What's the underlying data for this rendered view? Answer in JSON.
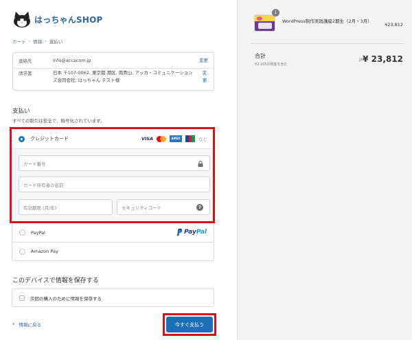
{
  "logo": {
    "text": "はっちゃんSHOP"
  },
  "breadcrumb": {
    "items": [
      "カート",
      "情報",
      "支払い"
    ],
    "separator": "›"
  },
  "contact": {
    "label": "連絡先",
    "value": "info@accacom.jp",
    "change": "変更"
  },
  "billing": {
    "label": "請求書",
    "value": "日本 〒107-0062, 東京都 港区, 南青山, アッカ・コミュニケーションズ合同会社, はっちゃん テスト様",
    "change": "変更"
  },
  "payment": {
    "title": "支払い",
    "subtitle": "すべての取引は安全で、暗号化されています。",
    "credit_card_label": "クレジットカード",
    "brands": {
      "visa": "VISA",
      "amex": "AMEX",
      "more": "など"
    },
    "card_number_placeholder": "カード番号",
    "card_name_placeholder": "カード所有者の名前",
    "expiry_placeholder": "有効期限 (月/年)",
    "security_placeholder": "セキュリティコード",
    "help_icon_text": "?",
    "paypal_label": "PayPal",
    "paypal_logo_a": "Pay",
    "paypal_logo_b": "Pal",
    "amazon_label": "Amazon Pay"
  },
  "save": {
    "title": "このデバイスで情報を保存する",
    "checkbox_label": "次回の購入のために情報を保存する"
  },
  "nav": {
    "back_label": "情報に戻る",
    "back_chevron": "‹",
    "pay_label": "今すぐ支払う"
  },
  "summary": {
    "product_name": "WordPress制作実践講座2期生（2月・3月）",
    "product_price": "¥23,812",
    "quantity": "1",
    "total_label": "合計",
    "tax_note": "¥2,165の税金を含む",
    "currency": "JPY",
    "total_value": "¥ 23,812"
  },
  "colors": {
    "accent": "#1c6fb7",
    "highlight": "#d3141b",
    "link": "#2a66a8"
  },
  "icons": [
    "cat-logo-icon",
    "lock-icon",
    "help-icon",
    "paypal-icon",
    "mastercard-icon",
    "jcb-icon"
  ]
}
